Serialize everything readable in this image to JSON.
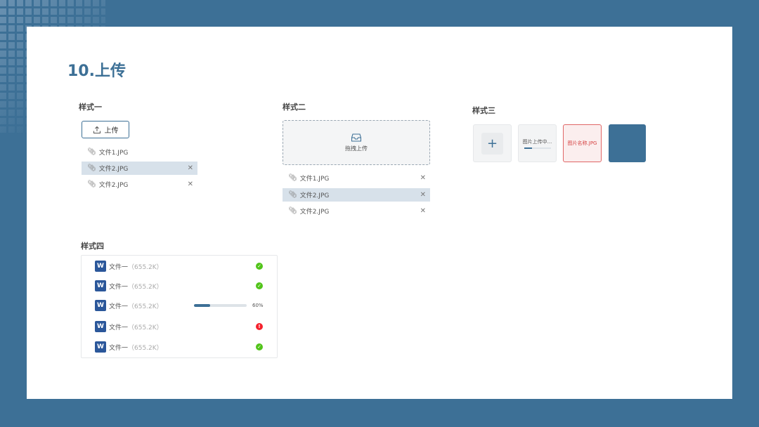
{
  "page": {
    "title": "10.上传",
    "bg_color": "#3d7096"
  },
  "style1": {
    "title": "样式一",
    "upload_label": "上传",
    "files": [
      {
        "name": "文件1.JPG",
        "active": false,
        "removable": false
      },
      {
        "name": "文件2.JPG",
        "active": true,
        "removable": true
      },
      {
        "name": "文件2.JPG",
        "active": false,
        "removable": true
      }
    ]
  },
  "style2": {
    "title": "样式二",
    "dropzone_label": "拖拽上传",
    "files": [
      {
        "name": "文件1.JPG",
        "active": false
      },
      {
        "name": "文件2.JPG",
        "active": true
      },
      {
        "name": "文件2.JPG",
        "active": false
      }
    ]
  },
  "style3": {
    "title": "样式三",
    "add_symbol": "+",
    "loading_label": "图片上传中...",
    "loading_progress": 0.3,
    "error_label": "图片名称.JPG",
    "image_color": "#3d7096",
    "error_color": "#d64545"
  },
  "style4": {
    "title": "样式四",
    "files": [
      {
        "name": "文件一",
        "size": "（655.2K）",
        "status": "success"
      },
      {
        "name": "文件一",
        "size": "（655.2K）",
        "status": "success"
      },
      {
        "name": "文件一",
        "size": "（655.2K）",
        "status": "uploading",
        "progress": 0.3,
        "progress_text": "60%"
      },
      {
        "name": "文件一",
        "size": "（655.2K）",
        "status": "error"
      },
      {
        "name": "文件一",
        "size": "（655.2K）",
        "status": "success"
      }
    ],
    "success_color": "#52c41a",
    "error_color": "#f5222d"
  }
}
